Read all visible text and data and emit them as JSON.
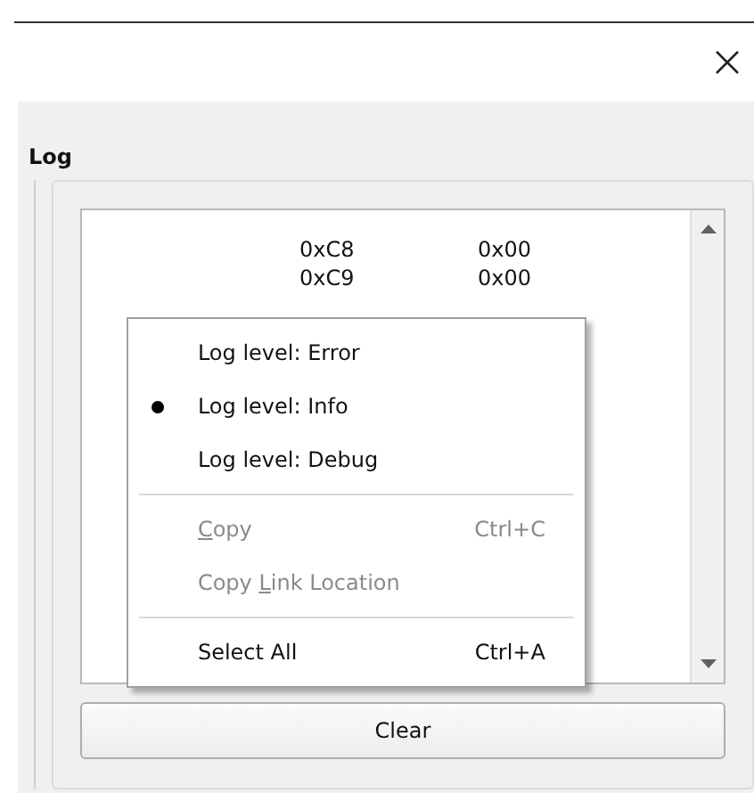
{
  "panel": {
    "title": "Log"
  },
  "log_rows": [
    {
      "address": "0xC8",
      "value": "0x00"
    },
    {
      "address": "0xC9",
      "value": "0x00"
    }
  ],
  "context_menu": {
    "items": [
      {
        "kind": "radio",
        "label": "Log level: Error",
        "selected": false,
        "disabled": false
      },
      {
        "kind": "radio",
        "label": "Log level: Info",
        "selected": true,
        "disabled": false
      },
      {
        "kind": "radio",
        "label": "Log level: Debug",
        "selected": false,
        "disabled": false
      },
      {
        "kind": "separator"
      },
      {
        "kind": "action",
        "mnemonic": "C",
        "label_after": "opy",
        "shortcut": "Ctrl+C",
        "disabled": true
      },
      {
        "kind": "action",
        "label_before": "Copy ",
        "mnemonic": "L",
        "label_after": "ink Location",
        "disabled": true
      },
      {
        "kind": "separator"
      },
      {
        "kind": "action",
        "label": "Select All",
        "shortcut": "Ctrl+A",
        "disabled": false
      }
    ]
  },
  "clear_button": {
    "label": "Clear"
  }
}
